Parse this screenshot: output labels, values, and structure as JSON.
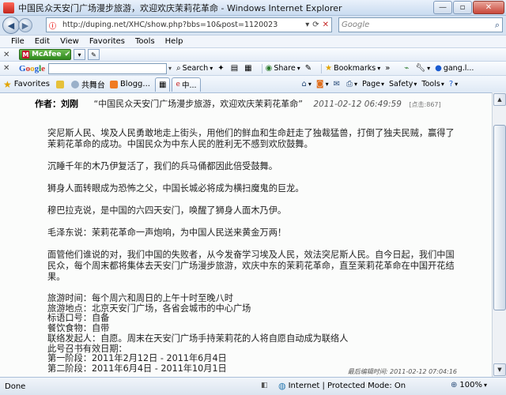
{
  "window": {
    "title": "中国民众天安门广场漫步旅游，欢迎欢庆茉莉花革命 - Windows Internet Explorer",
    "minimize": "—",
    "maximize": "▫",
    "close": "✕"
  },
  "address": {
    "url": "http://duping.net/XHC/show.php?bbs=10&post=1120023",
    "search_placeholder": "Google"
  },
  "menu": [
    "File",
    "Edit",
    "View",
    "Favorites",
    "Tools",
    "Help"
  ],
  "mcafee": {
    "label": "McAfee"
  },
  "google_bar": {
    "search": "Search",
    "share": "Share",
    "bookmarks": "Bookmarks",
    "account": "gang.l..."
  },
  "favorites": {
    "label": "Favorites",
    "items": [
      "共舞台",
      "Blogg..."
    ],
    "tab": "中..."
  },
  "commands": {
    "page": "Page",
    "safety": "Safety",
    "tools": "Tools"
  },
  "post": {
    "author_label": "作者：刘刚",
    "title": "“中国民众天安门广场漫步旅游，欢迎欢庆茉莉花革命”",
    "date": "2011-02-12 06:49:59",
    "clicks": "[点击:867]",
    "paragraphs": [
      "突尼斯人民、埃及人民勇敢地走上街头，用他们的鲜血和生命赶走了独裁猛兽，打倒了独夫民贼，赢得了茉莉花革命的成功。中国民众为中东人民的胜利无不感到欢欣鼓舞。",
      "沉睡千年的木乃伊复活了，我们的兵马俑都因此倍受鼓舞。",
      "狮身人面转眼成为恐怖之父，中国长城必将成为横扫魔鬼的巨龙。",
      "穆巴拉克说，是中国的六四天安门，唤醒了狮身人面木乃伊。",
      "毛泽东说：茉莉花革命一声炮响，为中国人民送来黄金万两！",
      "面管他们谁说的对，我们中国的失败者，从今发奋学习埃及人民，效法突尼斯人民。自今日起，我们中国民众，每个周末都将集体去天安门广场漫步旅游，欢庆中东的茉莉花革命，直至茉莉花革命在中国开花结果。"
    ],
    "info_lines": [
      "旅游时间：每个周六和周日的上午十时至晚八时",
      "旅游地点：北京天安门广场，各省会城市的中心广场",
      "标语口号：自备",
      "餐饮食物：自带",
      "联络发起人：自愿。周末在天安门广场手持茉莉花的人将自愿自动成为联络人",
      "此号召书有效日期：",
      "第一阶段：2011年2月12日 - 2011年6月4日",
      "第二阶段：2011年6月4日 - 2011年10月1日"
    ],
    "last_edit": "最后编辑时间: 2011-02-12 07:04:16"
  },
  "status": {
    "text": "Done",
    "zone": "Internet | Protected Mode: On",
    "zoom": "100%"
  }
}
